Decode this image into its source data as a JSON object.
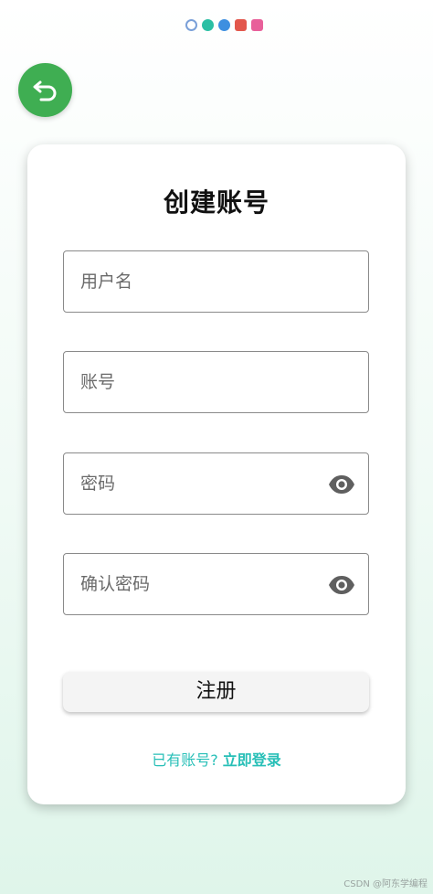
{
  "status_bar": {
    "icons": [
      "notification-icon-1",
      "notification-icon-2",
      "notification-icon-3",
      "notification-icon-4",
      "notification-icon-5"
    ]
  },
  "back_button": {
    "icon": "back-arrow-icon",
    "color": "#3fae52"
  },
  "card": {
    "title": "创建账号"
  },
  "fields": {
    "username": {
      "placeholder": "用户名",
      "value": ""
    },
    "account": {
      "placeholder": "账号",
      "value": ""
    },
    "password": {
      "placeholder": "密码",
      "value": "",
      "toggle_icon": "eye-icon"
    },
    "confirm_password": {
      "placeholder": "确认密码",
      "value": "",
      "toggle_icon": "eye-icon"
    }
  },
  "register_button": {
    "label": "注册"
  },
  "login_prompt": {
    "text": "已有账号? ",
    "link": "立即登录",
    "color": "#27bfb7"
  },
  "watermark": "CSDN @阿东学编程"
}
